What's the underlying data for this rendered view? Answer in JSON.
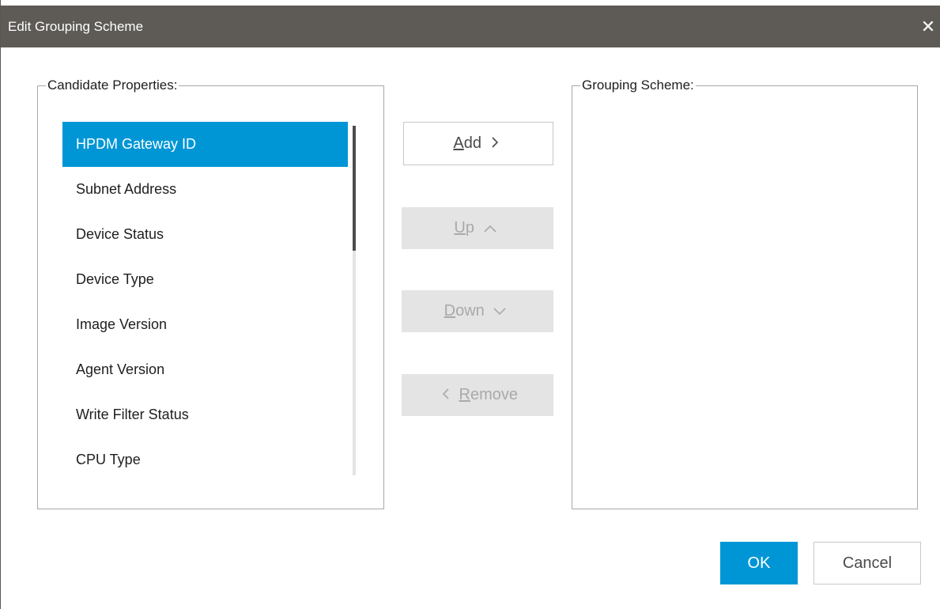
{
  "window": {
    "title": "Edit Grouping Scheme",
    "close_glyph": "✕"
  },
  "candidates": {
    "legend": "Candidate Properties:",
    "items": [
      {
        "label": "HPDM Gateway ID",
        "selected": true
      },
      {
        "label": "Subnet Address",
        "selected": false
      },
      {
        "label": "Device Status",
        "selected": false
      },
      {
        "label": "Device Type",
        "selected": false
      },
      {
        "label": "Image Version",
        "selected": false
      },
      {
        "label": "Agent Version",
        "selected": false
      },
      {
        "label": "Write Filter Status",
        "selected": false
      },
      {
        "label": "CPU Type",
        "selected": false
      }
    ]
  },
  "scheme": {
    "legend": "Grouping Scheme:",
    "items": []
  },
  "actions": {
    "add": {
      "mnemonic": "A",
      "rest": "dd",
      "icon": "chevron-right-icon",
      "glyph": ">",
      "enabled": true
    },
    "up": {
      "mnemonic": "U",
      "rest": "p",
      "icon": "chevron-up-icon",
      "glyph": "^",
      "enabled": false
    },
    "down": {
      "mnemonic": "D",
      "rest": "own",
      "icon": "chevron-down-icon",
      "glyph": "v",
      "enabled": false
    },
    "remove": {
      "mnemonic": "R",
      "rest": "emove",
      "icon": "chevron-left-icon",
      "glyph": "<",
      "enabled": false
    }
  },
  "footer": {
    "ok_label": "OK",
    "cancel_label": "Cancel"
  },
  "colors": {
    "titlebar": "#5e5b57",
    "accent": "#0096d6",
    "disabled_bg": "#e4e4e4",
    "disabled_text": "#a9a9a9"
  }
}
